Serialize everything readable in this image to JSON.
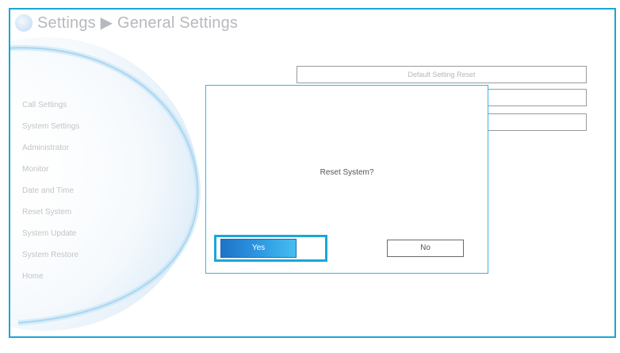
{
  "header": {
    "title": "Settings ▶ General Settings"
  },
  "menu": {
    "items": [
      "Call Settings",
      "System Settings",
      "Administrator",
      "Monitor",
      "Date and Time",
      "Reset System",
      "System Update",
      "System Restore",
      "Home"
    ]
  },
  "settings": {
    "default_reset_label": "Default Setting Reset"
  },
  "dialog": {
    "message": "Reset System?",
    "yes_label": "Yes",
    "no_label": "No"
  },
  "colors": {
    "accent": "#1ba6d6",
    "yes_button": "#2a93e0"
  }
}
